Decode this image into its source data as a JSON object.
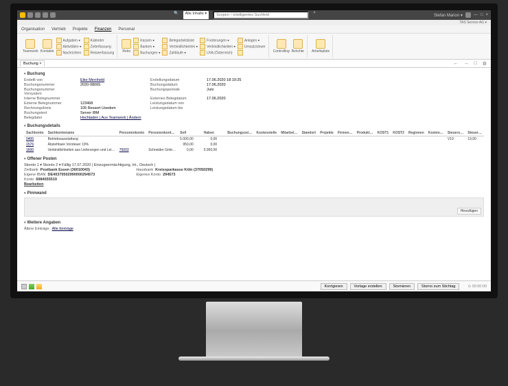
{
  "titlebar": {
    "search_scope": "Alle Inhalte ▾",
    "search_placeholder": "Scopen – intelligentes Suchfeld",
    "user": "Stefan Marion ▾",
    "company": "TAS Service AG ▾"
  },
  "menu": {
    "items": [
      "Organisation",
      "Vertrieb",
      "Projekte",
      "Finanzen",
      "Personal"
    ],
    "active": "Finanzen"
  },
  "ribbon": {
    "big": [
      "Teamwork",
      "Kontakte"
    ],
    "col1": [
      "Aufgaben ▾",
      "Aktivitäten ▾",
      "Nachrichten"
    ],
    "col2": [
      "Kalender",
      "Zeiterfassung",
      "Reiseerfassung"
    ],
    "big2": [
      "Reko"
    ],
    "col3": [
      "Kassen ▾",
      "Banken ▾",
      "Buchungen ▾"
    ],
    "col4": [
      "Belegarbeitsliste",
      "Verbindlichkeiten ▾",
      "Zahlläufe ▾"
    ],
    "col5": [
      "Forderungen ▾",
      "Verbindlichkeiten ▾",
      "UVA (Österreich)"
    ],
    "col6": [
      "Anlagen ▾",
      "Umsatzsteuer",
      ""
    ],
    "big3": [
      "Controlling",
      "Berichte",
      "Arbeitsplatz"
    ]
  },
  "tab": {
    "label": "Buchung",
    "close": "×"
  },
  "booking": {
    "title": "Buchung",
    "rows": [
      {
        "l1": "Erstellt von",
        "v1": "Eike Mernheld",
        "l2": "Erstellungsdatum",
        "v2": "17.06.2020 18:19:25"
      },
      {
        "l1": "Buchungsnummer",
        "v1": "2020-08065",
        "l2": "Buchungsdatum",
        "v2": "17.06.2020"
      },
      {
        "l1": "Buchungsnummer Vorsystem",
        "v1": "",
        "l2": "Buchungsperiode",
        "v2": "Juni"
      },
      {
        "l1": "Interne Belegnummer",
        "v1": "",
        "l2": "Externes Belegdatum",
        "v2": "17.06.2020"
      },
      {
        "l1": "Externe Belegnummer",
        "v1": "123468",
        "l2": "Leistungsdatum von",
        "v2": ""
      },
      {
        "l1": "Rechnungskreis",
        "v1": "105 Ressort Usedom",
        "l2": "Leistungsdatum bis",
        "v2": ""
      },
      {
        "l1": "Buchungstext",
        "v1": "Server IBM",
        "l2": "",
        "v2": ""
      },
      {
        "l1": "Belegdatei",
        "v1": "Hochladen | Aus Teamwork | Ändern",
        "l2": "",
        "v2": ""
      }
    ]
  },
  "details": {
    "title": "Buchungsdetails",
    "cols": [
      "Sachkonto",
      "Sachkontoname",
      "Personenkonto",
      "Personenkont…",
      "Soll",
      "Haben",
      "Buchungszei…",
      "Kostenstelle",
      "Mitarbei…",
      "Standort",
      "Projekte",
      "Firmen…",
      "Produkt…",
      "KOST1",
      "KOST2",
      "Regionen",
      "Kosten…",
      "Steuers…",
      "Steuer…"
    ],
    "rows": [
      {
        "k": "0400",
        "name": "Betriebsausstattung",
        "pk": "",
        "pkn": "",
        "soll": "5.000,00",
        "haben": "0,00",
        "st": "V19",
        "steuer": "19,00"
      },
      {
        "k": "1576",
        "name": "Abziehbare Vorsteuer 19%",
        "pk": "",
        "pkn": "",
        "soll": "950,00",
        "haben": "0,00",
        "st": "",
        "steuer": ""
      },
      {
        "k": "1600",
        "name": "Verbindlichkeiten aus Lieferungen und Lei…",
        "pk": "70003",
        "pkn": "Schneider Gmb…",
        "soll": "0,00",
        "haben": "5.950,00",
        "st": "",
        "steuer": ""
      }
    ]
  },
  "open": {
    "title": "Offener Posten",
    "line": "Skonto 1 ▾  Skonto 2 ▾  Fällig 17.07.2020 | Einzugsermächtigung, Inl., Deutsch |",
    "left": [
      {
        "l": "Zielbank",
        "v": "Postbank Essen (36010043)"
      },
      {
        "l": "Eigene IBAN",
        "v": "DE40370502990000294573"
      },
      {
        "l": "Konto",
        "v": "6984555519"
      },
      {
        "l": "",
        "v": "Bearbeiten"
      }
    ],
    "right": [
      {
        "l": "Hausbank",
        "v": "Kreissparkasse Köln (37050299)"
      },
      {
        "l": "Eigenes Konto",
        "v": "294573"
      }
    ]
  },
  "pinn": {
    "title": "Pinnwand",
    "add": "Hinzufügen"
  },
  "more": {
    "title": "Weitere Angaben",
    "older": "Ältere Einträge",
    "all": "Alle Einträge"
  },
  "footer": {
    "buttons": [
      "Korrigieren",
      "Vorlage erstellen",
      "Stornieren",
      "Storno zum Stichtag"
    ],
    "status": "⊙ 00:00:00"
  }
}
